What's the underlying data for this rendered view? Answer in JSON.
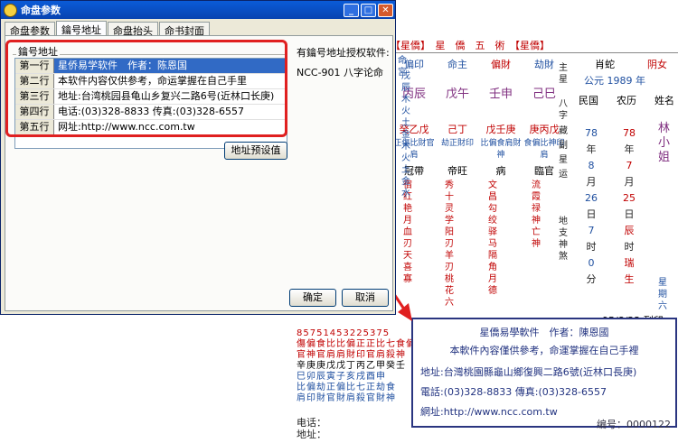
{
  "dialog": {
    "title": "命盘参数",
    "tabs": [
      "命盘参数",
      "鑰号地址",
      "命盘抬头",
      "命书封面"
    ],
    "group_label": "鑰号地址",
    "rows": [
      {
        "key": "第一行",
        "value": "星侨易学软件　作者：陈恩国"
      },
      {
        "key": "第二行",
        "value": "本软件内容仅供参考，命运掌握在自己手里"
      },
      {
        "key": "第三行",
        "value": "地址:台湾桃园县龟山乡复兴二路6号(近林口长庚)"
      },
      {
        "key": "第四行",
        "value": "电话:(03)328-8833 传真:(03)328-6557"
      },
      {
        "key": "第五行",
        "value": "网址:http://www.ncc.com.tw"
      }
    ],
    "preset_button": "地址预设值",
    "right_label": "有鑰号地址授权软件:",
    "right_value": "NCC-901 八字论命",
    "ok_button": "确定",
    "cancel_button": "取消"
  },
  "chart": {
    "header": "【星僑】　星　僑　五　術　【星僑】",
    "ming_gong": "命宮",
    "stems_top": [
      "偏印",
      "命主",
      "偏財",
      "劫財"
    ],
    "pillars": [
      "丙辰",
      "戊午",
      "壬申",
      "己巳"
    ],
    "hidden": [
      "癸乙戊",
      "己丁",
      "戊壬庚",
      "庚丙戊"
    ],
    "hidden_gods": [
      "正傷比財官肩",
      "劫正財印",
      "比偏食肩財神",
      "食偏比神印肩"
    ],
    "life_stage": [
      "冠帶",
      "帝旺",
      "病",
      "臨官"
    ],
    "left_col": "戊辰木火土金木火土金水",
    "zhuxing": "主星",
    "bazi": "八字",
    "zang": "藏",
    "fu": "副",
    "xing": "星",
    "yun": "运",
    "shensha": "地支神煞",
    "sha_cols": [
      "宿红艳月血刃天喜寡",
      "秀十灵学阳刃羊刃桃花六",
      "文昌勾绞驿马隔角月德",
      "流霞禄神亡神"
    ],
    "zodiac": "肖蛇",
    "gender": "阴女",
    "year_label": "公元 1989 年",
    "calendar": [
      "民国",
      "农历",
      "姓名"
    ],
    "name": "林小姐",
    "birth_left": [
      "78",
      "年",
      "8",
      "月",
      "26",
      "日",
      "7",
      "时",
      "0",
      "分"
    ],
    "birth_mid": [
      "78",
      "年",
      "7",
      "月",
      "25",
      "日",
      "辰",
      "时",
      "瑞",
      "生"
    ],
    "weekday": "星期六",
    "date_line": "95/8/22 列印",
    "bottom_rows": [
      "85751453225375",
      "傷偏食比比偏正正比七食偏",
      "官神官肩肩財印官肩殺神",
      "辛庚庚戊戊丁丙乙甲癸壬",
      "巳卯辰寅子亥戌酉申",
      "比偏劫正偏比七正劫食",
      "肩印財官財肩殺官財神"
    ],
    "bottom_labels": [
      "电话：",
      "地址："
    ],
    "serial": "编号：0000122"
  },
  "callout": {
    "lines": [
      "星僑易學軟件　作者：陳恩國",
      "本軟件內容僅供參考，命運掌握在自己手裡",
      "地址:台灣桃園縣龜山鄉復興二路6號(近林口長庚)",
      "電話:(03)328-8833 傳真:(03)328-6557",
      "網址:http://www.ncc.com.tw"
    ]
  },
  "colors": {
    "accent_red": "#e02020",
    "callout_border": "#2a3580",
    "title_blue": "#0a5bd8"
  }
}
